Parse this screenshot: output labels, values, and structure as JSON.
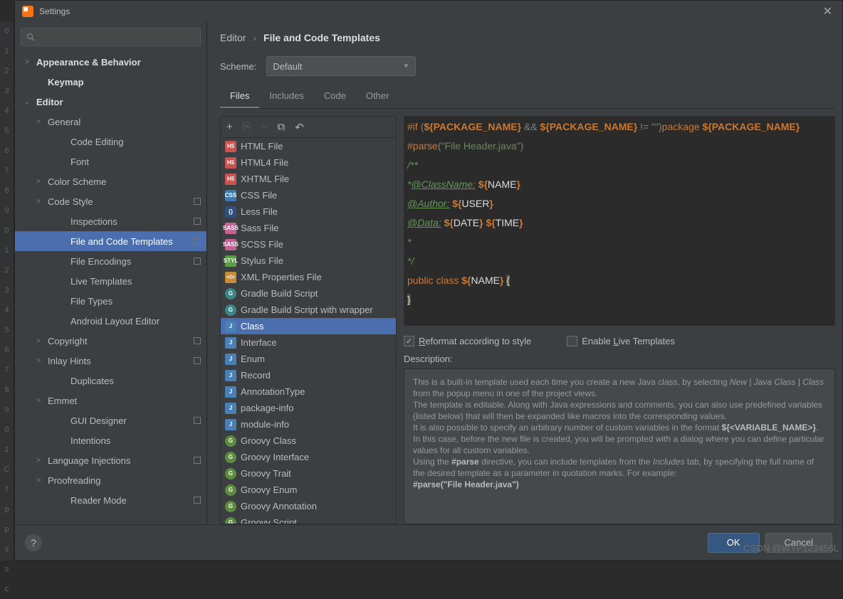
{
  "window": {
    "title": "Settings"
  },
  "gutter_lines": [
    "0",
    "1",
    "2",
    "3",
    "4",
    "5",
    "6",
    "7",
    "8",
    "9",
    "0",
    "1",
    "2",
    "3",
    "4",
    "5",
    "6",
    "7",
    "8",
    "9",
    "0",
    "1",
    "C",
    "f",
    "p",
    "p",
    "s",
    "s",
    "c"
  ],
  "breadcrumb": {
    "parent": "Editor",
    "child": "File and Code Templates"
  },
  "scheme": {
    "label": "Scheme:",
    "value": "Default"
  },
  "tabs": [
    "Files",
    "Includes",
    "Code",
    "Other"
  ],
  "sidebar": [
    {
      "lvl": 0,
      "chev": ">",
      "label": "Appearance & Behavior",
      "bold": true
    },
    {
      "lvl": 0,
      "chev": "",
      "label": "Keymap",
      "bold": true,
      "indent": 28
    },
    {
      "lvl": 0,
      "chev": "v",
      "label": "Editor",
      "bold": true
    },
    {
      "lvl": 1,
      "chev": ">",
      "label": "General"
    },
    {
      "lvl": 2,
      "chev": "",
      "label": "Code Editing"
    },
    {
      "lvl": 2,
      "chev": "",
      "label": "Font"
    },
    {
      "lvl": 1,
      "chev": ">",
      "label": "Color Scheme"
    },
    {
      "lvl": 1,
      "chev": ">",
      "label": "Code Style",
      "dot": true
    },
    {
      "lvl": 2,
      "chev": "",
      "label": "Inspections",
      "dot": true
    },
    {
      "lvl": 2,
      "chev": "",
      "label": "File and Code Templates",
      "sel": true,
      "dot": true
    },
    {
      "lvl": 2,
      "chev": "",
      "label": "File Encodings",
      "dot": true
    },
    {
      "lvl": 2,
      "chev": "",
      "label": "Live Templates"
    },
    {
      "lvl": 2,
      "chev": "",
      "label": "File Types"
    },
    {
      "lvl": 2,
      "chev": "",
      "label": "Android Layout Editor"
    },
    {
      "lvl": 1,
      "chev": ">",
      "label": "Copyright",
      "dot": true
    },
    {
      "lvl": 1,
      "chev": ">",
      "label": "Inlay Hints",
      "dot": true
    },
    {
      "lvl": 2,
      "chev": "",
      "label": "Duplicates"
    },
    {
      "lvl": 1,
      "chev": ">",
      "label": "Emmet"
    },
    {
      "lvl": 2,
      "chev": "",
      "label": "GUI Designer",
      "dot": true
    },
    {
      "lvl": 2,
      "chev": "",
      "label": "Intentions"
    },
    {
      "lvl": 1,
      "chev": ">",
      "label": "Language Injections",
      "dot": true
    },
    {
      "lvl": 1,
      "chev": ">",
      "label": "Proofreading"
    },
    {
      "lvl": 2,
      "chev": "",
      "label": "Reader Mode",
      "dot": true
    }
  ],
  "templates": [
    {
      "icon": "html",
      "label": "HTML File"
    },
    {
      "icon": "html",
      "label": "HTML4 File"
    },
    {
      "icon": "html",
      "label": "XHTML File"
    },
    {
      "icon": "css",
      "label": "CSS File"
    },
    {
      "icon": "less",
      "label": "Less File"
    },
    {
      "icon": "sass",
      "label": "Sass File"
    },
    {
      "icon": "sass",
      "label": "SCSS File"
    },
    {
      "icon": "styl",
      "label": "Stylus File"
    },
    {
      "icon": "xml",
      "label": "XML Properties File"
    },
    {
      "icon": "gradle",
      "label": "Gradle Build Script"
    },
    {
      "icon": "gradle",
      "label": "Gradle Build Script with wrapper"
    },
    {
      "icon": "java",
      "label": "Class",
      "sel": true
    },
    {
      "icon": "java",
      "label": "Interface"
    },
    {
      "icon": "java",
      "label": "Enum"
    },
    {
      "icon": "java",
      "label": "Record"
    },
    {
      "icon": "java",
      "label": "AnnotationType"
    },
    {
      "icon": "java",
      "label": "package-info"
    },
    {
      "icon": "java",
      "label": "module-info"
    },
    {
      "icon": "groovy",
      "label": "Groovy Class"
    },
    {
      "icon": "groovy",
      "label": "Groovy Interface"
    },
    {
      "icon": "groovy",
      "label": "Groovy Trait"
    },
    {
      "icon": "groovy",
      "label": "Groovy Enum"
    },
    {
      "icon": "groovy",
      "label": "Groovy Annotation"
    },
    {
      "icon": "groovy",
      "label": "Groovy Script"
    }
  ],
  "code": {
    "l1a": "#if ",
    "l1b": "(",
    "l1c": "${PACKAGE_NAME}",
    "l1d": " && ",
    "l1e": "${PACKAGE_NAME}",
    "l1f": " != ",
    "l1g": "\"\"",
    "l1h": ")",
    "l1i": "package ",
    "l1j": "${PACKAGE_NAME}",
    "l2a": "#parse",
    "l2b": "(",
    "l2c": "\"File Header.java\"",
    "l2d": ")",
    "l3": "/**",
    "l4a": "*",
    "l4b": "@ClassName:",
    "l4c": " ${",
    "l4d": "NAME",
    "l4e": "}",
    "l5a": "@Author:",
    "l5b": " ${",
    "l5c": "USER",
    "l5d": "}",
    "l6a": "@Data:",
    "l6b": " ${",
    "l6c": "DATE",
    "l6d": "} ${",
    "l6e": "TIME",
    "l6f": "}",
    "l7": "*",
    "l8": "*/",
    "l9a": "public class ",
    "l9b": "${",
    "l9c": "NAME",
    "l9d": "} ",
    "l9e": "{",
    "l10": "}"
  },
  "checks": {
    "reformat": "Reformat according to style",
    "live": "Enable Live Templates"
  },
  "desc": {
    "label": "Description:",
    "p1a": "This is a built-in template used each time you create a new Java class, by selecting ",
    "p1b": "New | Java Class | Class",
    "p1c": " from the popup menu in one of the project views.",
    "p2": "The template is editable. Along with Java expressions and comments, you can also use predefined variables (listed below) that will then be expanded like macros into the corresponding values.",
    "p3a": "It is also possible to specify an arbitrary number of custom variables in the format ",
    "p3b": "${<VARIABLE_NAME>}",
    "p3c": ". In this case, before the new file is created, you will be prompted with a dialog where you can define particular values for all custom variables.",
    "p4a": "Using the ",
    "p4b": "#parse",
    "p4c": " directive, you can include templates from the ",
    "p4d": "Includes",
    "p4e": " tab, by specifying the full name of the desired template as a parameter in quotation marks. For example:",
    "p5": "#parse(\"File Header.java\")"
  },
  "footer": {
    "ok": "OK",
    "cancel": "Cancel"
  },
  "watermark": "CSDN @WYP123456L"
}
